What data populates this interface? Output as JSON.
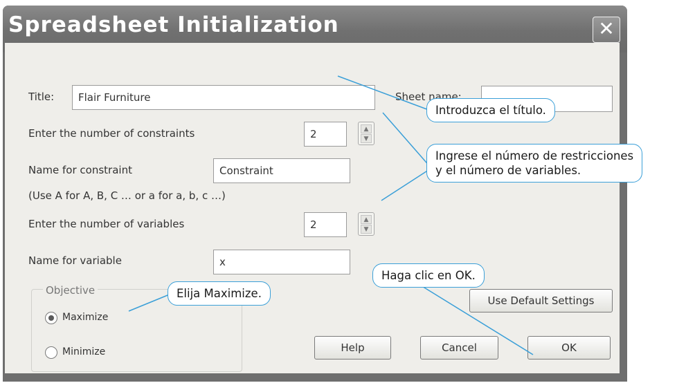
{
  "dialog": {
    "title": "Spreadsheet Initialization",
    "close_glyph": "✕"
  },
  "form": {
    "title_label": "Title:",
    "title_value": "Flair Furniture",
    "sheet_name_label": "Sheet name:",
    "sheet_name_value": "",
    "constraints_label": "Enter the number of constraints",
    "constraints_value": "2",
    "constraint_name_label": "Name for constraint",
    "constraint_name_value": "Constraint",
    "naming_hint": "(Use A for A, B, C … or a for a, b, c …)",
    "variables_label": "Enter the number of variables",
    "variables_value": "2",
    "variable_name_label": "Name for variable",
    "variable_name_value": "x"
  },
  "objective": {
    "legend": "Objective",
    "options": [
      {
        "label": "Maximize",
        "selected": true
      },
      {
        "label": "Minimize",
        "selected": false
      }
    ]
  },
  "buttons": {
    "defaults": "Use Default Settings",
    "help": "Help",
    "cancel": "Cancel",
    "ok": "OK"
  },
  "callouts": {
    "title": "Introduzca el título.",
    "counts_line1": "Ingrese el número de restricciones",
    "counts_line2": "y el número de variables.",
    "ok": "Haga clic en OK.",
    "maximize": "Elija Maximize."
  },
  "colors": {
    "callout_border": "#3a9fd8",
    "dialog_bg": "#efeeea",
    "titlebar": "#707070"
  }
}
